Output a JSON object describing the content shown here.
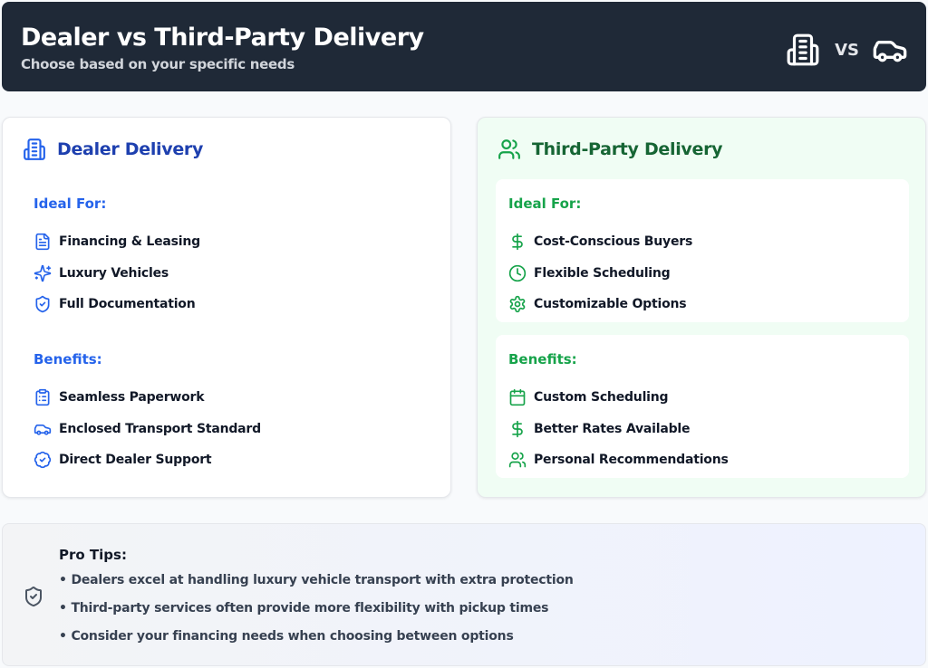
{
  "header": {
    "title": "Dealer vs Third-Party Delivery",
    "subtitle": "Choose based on your specific needs",
    "vs_label": "VS",
    "left_icon": "building-icon",
    "right_icon": "car-icon"
  },
  "colors": {
    "header_bg": "#1f2937",
    "dealer_accent": "#2563eb",
    "dealer_title": "#1e40af",
    "third_accent": "#16a34a",
    "third_title": "#166534",
    "third_bg": "#f0fdf4"
  },
  "dealer": {
    "title": "Dealer Delivery",
    "icon": "building-icon",
    "ideal_title": "Ideal For:",
    "ideal": [
      {
        "label": "Financing & Leasing",
        "icon": "file-text-icon"
      },
      {
        "label": "Luxury Vehicles",
        "icon": "sparkles-icon"
      },
      {
        "label": "Full Documentation",
        "icon": "shield-check-icon"
      }
    ],
    "benefits_title": "Benefits:",
    "benefits": [
      {
        "label": "Seamless Paperwork",
        "icon": "clipboard-list-icon"
      },
      {
        "label": "Enclosed Transport Standard",
        "icon": "car-icon"
      },
      {
        "label": "Direct Dealer Support",
        "icon": "badge-check-icon"
      }
    ]
  },
  "third_party": {
    "title": "Third-Party Delivery",
    "icon": "users-icon",
    "ideal_title": "Ideal For:",
    "ideal": [
      {
        "label": "Cost-Conscious Buyers",
        "icon": "dollar-sign-icon"
      },
      {
        "label": "Flexible Scheduling",
        "icon": "clock-icon"
      },
      {
        "label": "Customizable Options",
        "icon": "settings-icon"
      }
    ],
    "benefits_title": "Benefits:",
    "benefits": [
      {
        "label": "Custom Scheduling",
        "icon": "calendar-icon"
      },
      {
        "label": "Better Rates Available",
        "icon": "dollar-sign-icon"
      },
      {
        "label": "Personal Recommendations",
        "icon": "users-icon"
      }
    ]
  },
  "tips": {
    "title": "Pro Tips:",
    "icon": "shield-check-icon",
    "items": [
      "Dealers excel at handling luxury vehicle transport with extra protection",
      "Third-party services often provide more flexibility with pickup times",
      "Consider your financing needs when choosing between options"
    ]
  }
}
